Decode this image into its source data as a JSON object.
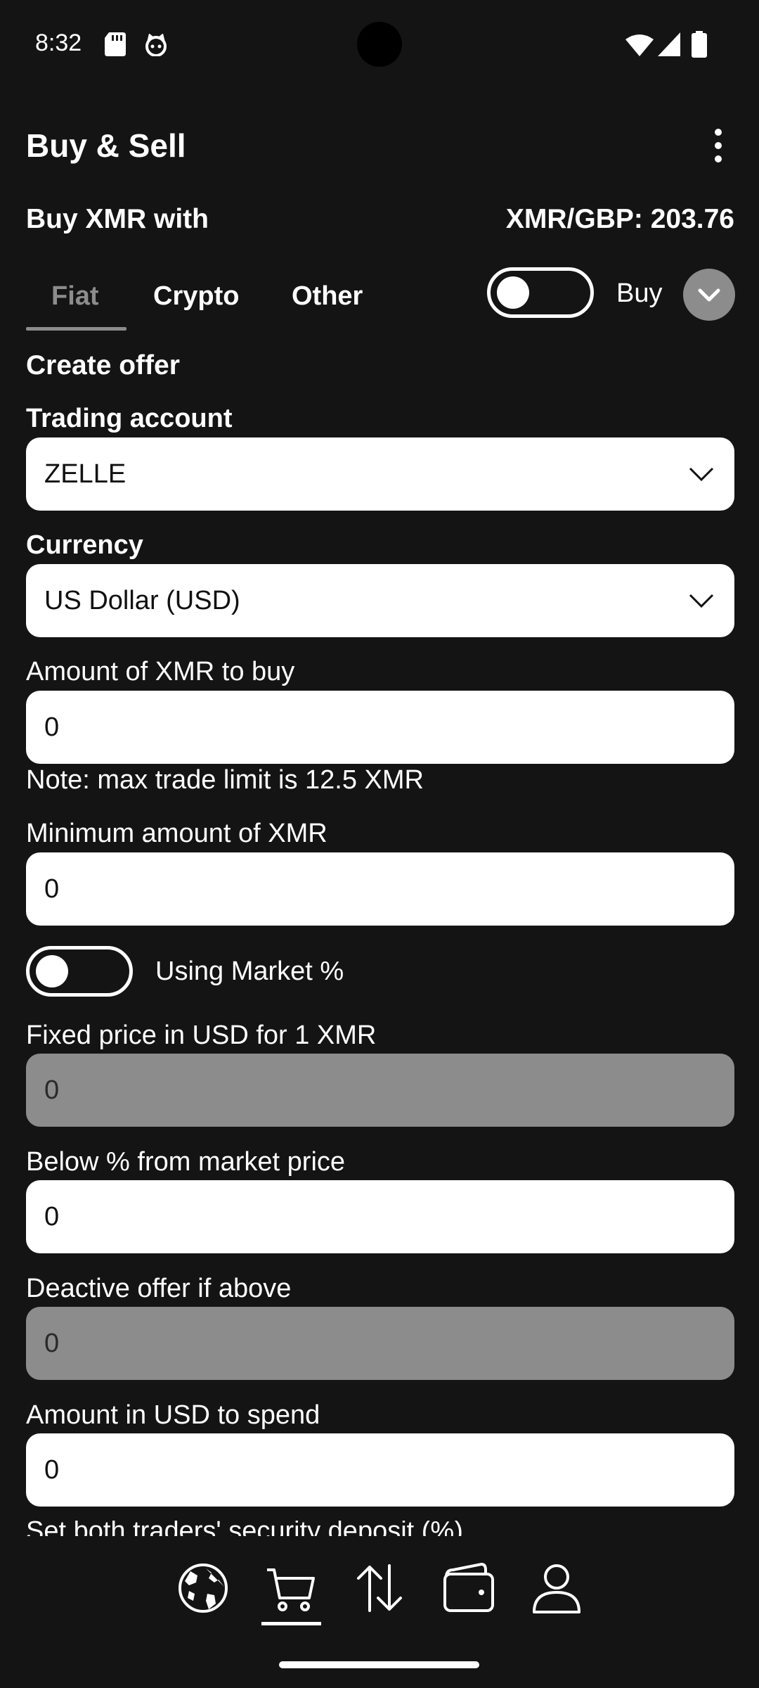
{
  "status_bar": {
    "time": "8:32",
    "icons": [
      "sd-card-icon",
      "cat-icon",
      "wifi-icon",
      "signal-icon",
      "battery-icon"
    ]
  },
  "header": {
    "title": "Buy & Sell",
    "menu_icon": "more-vertical-icon"
  },
  "subheader": {
    "buy_with": "Buy XMR with",
    "rate": "XMR/GBP: 203.76"
  },
  "tabs": [
    {
      "label": "Fiat",
      "active": true
    },
    {
      "label": "Crypto",
      "active": false
    },
    {
      "label": "Other",
      "active": false
    }
  ],
  "mode_toggle": {
    "label": "Buy",
    "on": false
  },
  "form": {
    "section_title": "Create offer",
    "trading_account": {
      "label": "Trading account",
      "value": "ZELLE"
    },
    "currency": {
      "label": "Currency",
      "value": "US Dollar (USD)"
    },
    "amount": {
      "label": "Amount of XMR to buy",
      "value": "0"
    },
    "note": "Note: max trade limit is 12.5 XMR",
    "min_amount": {
      "label": "Minimum amount of XMR",
      "value": "0"
    },
    "market_toggle": {
      "label": "Using Market %",
      "on": false
    },
    "fixed_price": {
      "label": "Fixed price in USD for 1 XMR",
      "value": "0",
      "disabled": true
    },
    "below_market": {
      "label": "Below % from market price",
      "value": "0"
    },
    "deactivate": {
      "label": "Deactive offer if above",
      "value": "0",
      "disabled": true
    },
    "amount_usd": {
      "label": "Amount in USD to spend",
      "value": "0"
    },
    "security_deposit_label": "Set both traders' security deposit (%)"
  },
  "bottom_nav": {
    "items": [
      {
        "name": "globe-icon",
        "active": false
      },
      {
        "name": "cart-icon",
        "active": true
      },
      {
        "name": "transfer-icon",
        "active": false
      },
      {
        "name": "wallet-icon",
        "active": false
      },
      {
        "name": "account-icon",
        "active": false
      }
    ]
  },
  "colors": {
    "background": "#141414",
    "field": "#ffffff",
    "field_disabled": "#8c8c8c",
    "tab_inactive_text": "#ffffff",
    "tab_active": "#8c8c8c"
  }
}
